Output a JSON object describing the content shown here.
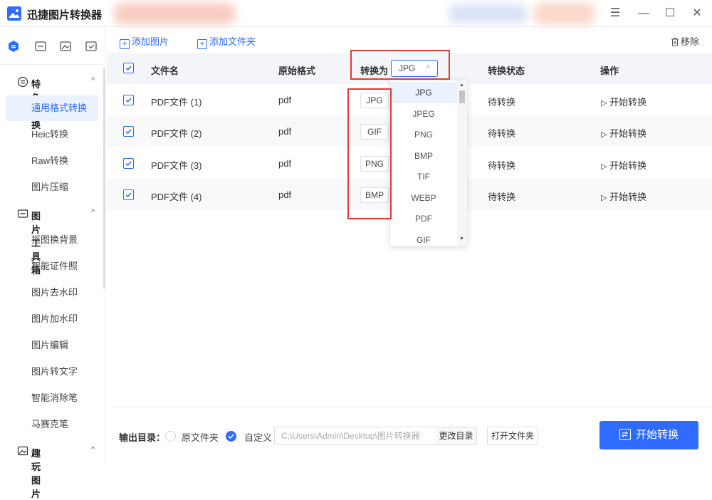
{
  "app": {
    "title": "迅捷图片转换器"
  },
  "window": {
    "minimize": "—",
    "maximize": "☐",
    "close": "✕",
    "menu": "☰"
  },
  "sidebar": {
    "groups": [
      {
        "label": "特色转换",
        "items": [
          "通用格式转换",
          "Heic转换",
          "Raw转换",
          "图片压缩"
        ]
      },
      {
        "label": "图片工具箱",
        "items": [
          "抠图换背景",
          "智能证件照",
          "图片去水印",
          "图片加水印",
          "图片编辑",
          "图片转文字",
          "智能消除笔",
          "马赛克笔"
        ]
      },
      {
        "label": "趣玩图片",
        "items": []
      }
    ],
    "active_item": "通用格式转换"
  },
  "toolbar": {
    "add_image": "添加图片",
    "add_folder": "添加文件夹",
    "remove": "移除"
  },
  "table": {
    "headers": {
      "filename": "文件名",
      "orig_format": "原始格式",
      "convert_to": "转换为",
      "status": "转换状态",
      "action": "操作"
    },
    "header_format": "JPG",
    "rows": [
      {
        "name": "PDF文件 (1)",
        "orig": "pdf",
        "target": "JPG",
        "status": "待转换",
        "action": "开始转换"
      },
      {
        "name": "PDF文件 (2)",
        "orig": "pdf",
        "target": "GIF",
        "status": "待转换",
        "action": "开始转换"
      },
      {
        "name": "PDF文件 (3)",
        "orig": "pdf",
        "target": "PNG",
        "status": "待转换",
        "action": "开始转换"
      },
      {
        "name": "PDF文件 (4)",
        "orig": "pdf",
        "target": "BMP",
        "status": "待转换",
        "action": "开始转换"
      }
    ]
  },
  "dropdown": {
    "options": [
      "JPG",
      "JPEG",
      "PNG",
      "BMP",
      "TIF",
      "WEBP",
      "PDF",
      "GIF"
    ],
    "selected": "JPG"
  },
  "bottom": {
    "output_label": "输出目录：",
    "option_original": "原文件夹",
    "option_custom": "自定义",
    "path": "C:\\Users\\Admin\\Desktop\\图片转换器",
    "change_dir": "更改目录",
    "open_folder": "打开文件夹",
    "start_button": "开始转换"
  },
  "colors": {
    "accent": "#2f6bff",
    "highlight_box": "#e53935"
  }
}
